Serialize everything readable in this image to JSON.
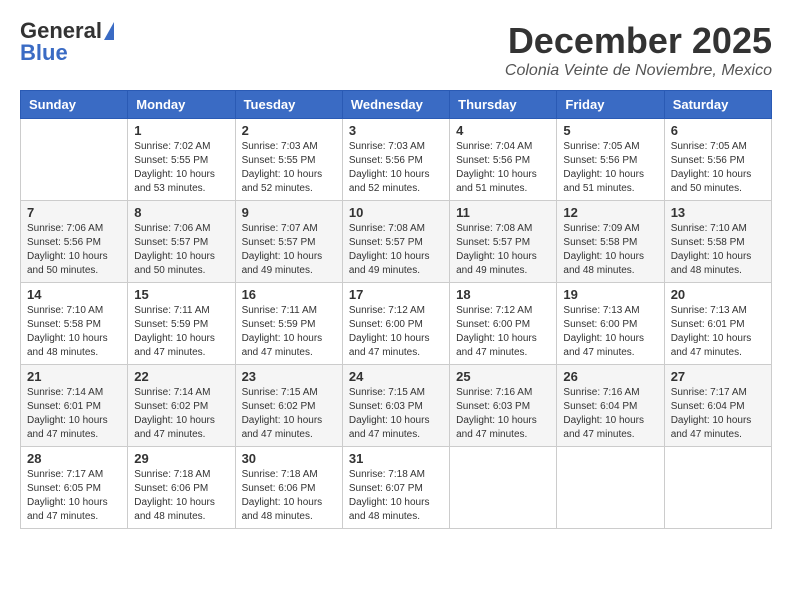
{
  "logo": {
    "general": "General",
    "blue": "Blue"
  },
  "header": {
    "month": "December 2025",
    "location": "Colonia Veinte de Noviembre, Mexico"
  },
  "weekdays": [
    "Sunday",
    "Monday",
    "Tuesday",
    "Wednesday",
    "Thursday",
    "Friday",
    "Saturday"
  ],
  "weeks": [
    [
      {
        "day": "",
        "info": ""
      },
      {
        "day": "1",
        "info": "Sunrise: 7:02 AM\nSunset: 5:55 PM\nDaylight: 10 hours\nand 53 minutes."
      },
      {
        "day": "2",
        "info": "Sunrise: 7:03 AM\nSunset: 5:55 PM\nDaylight: 10 hours\nand 52 minutes."
      },
      {
        "day": "3",
        "info": "Sunrise: 7:03 AM\nSunset: 5:56 PM\nDaylight: 10 hours\nand 52 minutes."
      },
      {
        "day": "4",
        "info": "Sunrise: 7:04 AM\nSunset: 5:56 PM\nDaylight: 10 hours\nand 51 minutes."
      },
      {
        "day": "5",
        "info": "Sunrise: 7:05 AM\nSunset: 5:56 PM\nDaylight: 10 hours\nand 51 minutes."
      },
      {
        "day": "6",
        "info": "Sunrise: 7:05 AM\nSunset: 5:56 PM\nDaylight: 10 hours\nand 50 minutes."
      }
    ],
    [
      {
        "day": "7",
        "info": "Sunrise: 7:06 AM\nSunset: 5:56 PM\nDaylight: 10 hours\nand 50 minutes."
      },
      {
        "day": "8",
        "info": "Sunrise: 7:06 AM\nSunset: 5:57 PM\nDaylight: 10 hours\nand 50 minutes."
      },
      {
        "day": "9",
        "info": "Sunrise: 7:07 AM\nSunset: 5:57 PM\nDaylight: 10 hours\nand 49 minutes."
      },
      {
        "day": "10",
        "info": "Sunrise: 7:08 AM\nSunset: 5:57 PM\nDaylight: 10 hours\nand 49 minutes."
      },
      {
        "day": "11",
        "info": "Sunrise: 7:08 AM\nSunset: 5:57 PM\nDaylight: 10 hours\nand 49 minutes."
      },
      {
        "day": "12",
        "info": "Sunrise: 7:09 AM\nSunset: 5:58 PM\nDaylight: 10 hours\nand 48 minutes."
      },
      {
        "day": "13",
        "info": "Sunrise: 7:10 AM\nSunset: 5:58 PM\nDaylight: 10 hours\nand 48 minutes."
      }
    ],
    [
      {
        "day": "14",
        "info": "Sunrise: 7:10 AM\nSunset: 5:58 PM\nDaylight: 10 hours\nand 48 minutes."
      },
      {
        "day": "15",
        "info": "Sunrise: 7:11 AM\nSunset: 5:59 PM\nDaylight: 10 hours\nand 47 minutes."
      },
      {
        "day": "16",
        "info": "Sunrise: 7:11 AM\nSunset: 5:59 PM\nDaylight: 10 hours\nand 47 minutes."
      },
      {
        "day": "17",
        "info": "Sunrise: 7:12 AM\nSunset: 6:00 PM\nDaylight: 10 hours\nand 47 minutes."
      },
      {
        "day": "18",
        "info": "Sunrise: 7:12 AM\nSunset: 6:00 PM\nDaylight: 10 hours\nand 47 minutes."
      },
      {
        "day": "19",
        "info": "Sunrise: 7:13 AM\nSunset: 6:00 PM\nDaylight: 10 hours\nand 47 minutes."
      },
      {
        "day": "20",
        "info": "Sunrise: 7:13 AM\nSunset: 6:01 PM\nDaylight: 10 hours\nand 47 minutes."
      }
    ],
    [
      {
        "day": "21",
        "info": "Sunrise: 7:14 AM\nSunset: 6:01 PM\nDaylight: 10 hours\nand 47 minutes."
      },
      {
        "day": "22",
        "info": "Sunrise: 7:14 AM\nSunset: 6:02 PM\nDaylight: 10 hours\nand 47 minutes."
      },
      {
        "day": "23",
        "info": "Sunrise: 7:15 AM\nSunset: 6:02 PM\nDaylight: 10 hours\nand 47 minutes."
      },
      {
        "day": "24",
        "info": "Sunrise: 7:15 AM\nSunset: 6:03 PM\nDaylight: 10 hours\nand 47 minutes."
      },
      {
        "day": "25",
        "info": "Sunrise: 7:16 AM\nSunset: 6:03 PM\nDaylight: 10 hours\nand 47 minutes."
      },
      {
        "day": "26",
        "info": "Sunrise: 7:16 AM\nSunset: 6:04 PM\nDaylight: 10 hours\nand 47 minutes."
      },
      {
        "day": "27",
        "info": "Sunrise: 7:17 AM\nSunset: 6:04 PM\nDaylight: 10 hours\nand 47 minutes."
      }
    ],
    [
      {
        "day": "28",
        "info": "Sunrise: 7:17 AM\nSunset: 6:05 PM\nDaylight: 10 hours\nand 47 minutes."
      },
      {
        "day": "29",
        "info": "Sunrise: 7:18 AM\nSunset: 6:06 PM\nDaylight: 10 hours\nand 48 minutes."
      },
      {
        "day": "30",
        "info": "Sunrise: 7:18 AM\nSunset: 6:06 PM\nDaylight: 10 hours\nand 48 minutes."
      },
      {
        "day": "31",
        "info": "Sunrise: 7:18 AM\nSunset: 6:07 PM\nDaylight: 10 hours\nand 48 minutes."
      },
      {
        "day": "",
        "info": ""
      },
      {
        "day": "",
        "info": ""
      },
      {
        "day": "",
        "info": ""
      }
    ]
  ]
}
